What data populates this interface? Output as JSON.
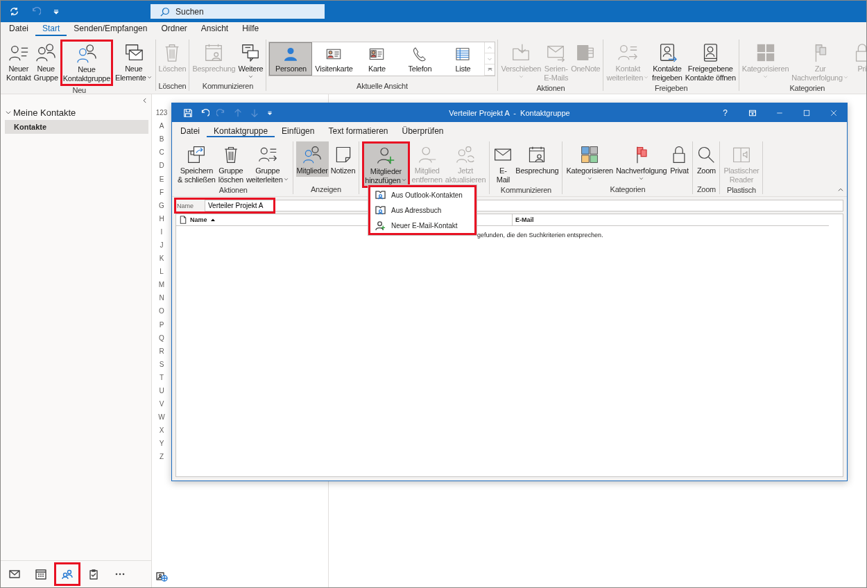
{
  "app_bar": {
    "search_placeholder": "Suchen"
  },
  "menu_tabs": [
    {
      "label": "Datei",
      "selected": false
    },
    {
      "label": "Start",
      "selected": true
    },
    {
      "label": "Senden/Empfangen",
      "selected": false
    },
    {
      "label": "Ordner",
      "selected": false
    },
    {
      "label": "Ansicht",
      "selected": false
    },
    {
      "label": "Hilfe",
      "selected": false
    }
  ],
  "ribbon": {
    "groups": [
      {
        "label": "Neu",
        "kind": "buttons",
        "buttons": [
          {
            "lines": [
              "Neuer",
              "Kontakt"
            ],
            "disabled": false,
            "dropdown": false,
            "highlighted": false
          },
          {
            "lines": [
              "Neue",
              "Gruppe"
            ],
            "disabled": false,
            "dropdown": false,
            "highlighted": false
          },
          {
            "lines": [
              "Neue",
              "Kontaktgruppe"
            ],
            "disabled": false,
            "dropdown": false,
            "highlighted": true
          },
          {
            "lines": [
              "Neue",
              "Elemente"
            ],
            "disabled": false,
            "dropdown": true,
            "highlighted": false
          }
        ]
      },
      {
        "label": "Löschen",
        "kind": "buttons",
        "buttons": [
          {
            "lines": [
              "Löschen"
            ],
            "disabled": true,
            "dropdown": false,
            "highlighted": false
          }
        ]
      },
      {
        "label": "Kommunizieren",
        "kind": "buttons",
        "buttons": [
          {
            "lines": [
              "Besprechung"
            ],
            "disabled": true,
            "dropdown": false,
            "highlighted": false
          },
          {
            "lines": [
              "Weitere"
            ],
            "disabled": false,
            "dropdown": true,
            "highlighted": false
          }
        ]
      },
      {
        "label": "Aktuelle Ansicht",
        "kind": "gallery",
        "views": [
          {
            "label": "Personen",
            "selected": true
          },
          {
            "label": "Visitenkarte",
            "selected": false
          },
          {
            "label": "Karte",
            "selected": false
          },
          {
            "label": "Telefon",
            "selected": false
          },
          {
            "label": "Liste",
            "selected": false
          }
        ]
      },
      {
        "label": "Aktionen",
        "kind": "buttons",
        "buttons": [
          {
            "lines": [
              "Verschieben"
            ],
            "disabled": true,
            "dropdown": true,
            "highlighted": false
          },
          {
            "lines": [
              "Serien-",
              "E-Mails"
            ],
            "disabled": true,
            "dropdown": false,
            "highlighted": false
          },
          {
            "lines": [
              "OneNote"
            ],
            "disabled": true,
            "dropdown": false,
            "highlighted": false
          }
        ]
      },
      {
        "label": "Freigeben",
        "kind": "buttons",
        "buttons": [
          {
            "lines": [
              "Kontakt",
              "weiterleiten"
            ],
            "disabled": true,
            "dropdown": true,
            "highlighted": false
          },
          {
            "lines": [
              "Kontakte",
              "freigeben"
            ],
            "disabled": false,
            "dropdown": false,
            "highlighted": false
          },
          {
            "lines": [
              "Freigegebene",
              "Kontakte öffnen"
            ],
            "disabled": false,
            "dropdown": false,
            "highlighted": false
          }
        ]
      },
      {
        "label": "Kategorien",
        "kind": "buttons",
        "buttons": [
          {
            "lines": [
              "Kategorisieren"
            ],
            "disabled": true,
            "dropdown": true,
            "highlighted": false
          },
          {
            "lines": [
              "Zur",
              "Nachverfolgung"
            ],
            "disabled": true,
            "dropdown": true,
            "highlighted": false
          },
          {
            "lines": [
              "Pri"
            ],
            "disabled": true,
            "dropdown": false,
            "highlighted": false
          }
        ]
      }
    ]
  },
  "sidebar": {
    "header": "Meine Kontakte",
    "expanded": true,
    "folders": [
      {
        "label": "Kontakte",
        "selected": true
      }
    ],
    "nav": [
      {
        "selected": false,
        "highlighted": false
      },
      {
        "selected": false,
        "highlighted": false
      },
      {
        "selected": true,
        "highlighted": true
      },
      {
        "selected": false,
        "highlighted": false
      },
      {
        "selected": false,
        "highlighted": false
      }
    ]
  },
  "letter_index": [
    "123",
    "A",
    "B",
    "C",
    "D",
    "E",
    "F",
    "G",
    "H",
    "I",
    "J",
    "K",
    "L",
    "M",
    "N",
    "O",
    "P",
    "Q",
    "R",
    "S",
    "T",
    "U",
    "V",
    "W",
    "X",
    "Y",
    "Z"
  ],
  "contact_window": {
    "title": "Verteiler Projekt A  -  Kontaktgruppe",
    "help": "?",
    "tabs": [
      {
        "label": "Datei",
        "selected": false
      },
      {
        "label": "Kontaktgruppe",
        "selected": true
      },
      {
        "label": "Einfügen",
        "selected": false
      },
      {
        "label": "Text formatieren",
        "selected": false
      },
      {
        "label": "Überprüfen",
        "selected": false
      }
    ],
    "groups": [
      {
        "label": "Aktionen",
        "buttons": [
          {
            "lines": [
              "Speichern",
              "& schließen"
            ],
            "disabled": false,
            "dropdown": false,
            "pressed": false,
            "highlighted": false
          },
          {
            "lines": [
              "Gruppe",
              "löschen"
            ],
            "disabled": false,
            "dropdown": false,
            "pressed": false,
            "highlighted": false
          },
          {
            "lines": [
              "Gruppe",
              "weiterleiten"
            ],
            "disabled": false,
            "dropdown": true,
            "pressed": false,
            "highlighted": false
          }
        ]
      },
      {
        "label": "Anzeigen",
        "buttons": [
          {
            "lines": [
              "Mitglieder"
            ],
            "disabled": false,
            "dropdown": false,
            "pressed": true,
            "highlighted": false
          },
          {
            "lines": [
              "Notizen"
            ],
            "disabled": false,
            "dropdown": false,
            "pressed": false,
            "highlighted": false
          }
        ]
      },
      {
        "buttons": [
          {
            "lines": [
              "Mitglieder",
              "hinzufügen"
            ],
            "disabled": false,
            "dropdown": true,
            "pressed": true,
            "highlighted": true
          },
          {
            "lines": [
              "Mitglied",
              "entfernen"
            ],
            "disabled": true,
            "dropdown": false,
            "pressed": false,
            "highlighted": false
          },
          {
            "lines": [
              "Jetzt",
              "aktualisieren"
            ],
            "disabled": true,
            "dropdown": false,
            "pressed": false,
            "highlighted": false
          }
        ]
      },
      {
        "label": "Kommunizieren",
        "buttons": [
          {
            "lines": [
              "E-",
              "Mail"
            ],
            "disabled": false,
            "dropdown": false,
            "pressed": false,
            "highlighted": false
          },
          {
            "lines": [
              "Besprechung"
            ],
            "disabled": false,
            "dropdown": false,
            "pressed": false,
            "highlighted": false
          }
        ]
      },
      {
        "label": "Kategorien",
        "buttons": [
          {
            "lines": [
              "Kategorisieren"
            ],
            "disabled": false,
            "dropdown": true,
            "pressed": false,
            "highlighted": false
          },
          {
            "lines": [
              "Nachverfolgung"
            ],
            "disabled": false,
            "dropdown": true,
            "pressed": false,
            "highlighted": false
          },
          {
            "lines": [
              "Privat"
            ],
            "disabled": false,
            "dropdown": false,
            "pressed": false,
            "highlighted": false
          }
        ]
      },
      {
        "label": "Zoom",
        "buttons": [
          {
            "lines": [
              "Zoom"
            ],
            "disabled": false,
            "dropdown": false,
            "pressed": false,
            "highlighted": false
          }
        ]
      },
      {
        "label": "Plastisch",
        "buttons": [
          {
            "lines": [
              "Plastischer",
              "Reader"
            ],
            "disabled": true,
            "dropdown": false,
            "pressed": false,
            "highlighted": false
          }
        ]
      }
    ],
    "name_field": {
      "label": "Name",
      "value": "Verteiler Projekt A",
      "highlighted": true
    },
    "columns": [
      {
        "label": "Name",
        "sorted": true
      },
      {
        "label": "E-Mail",
        "sorted": false
      }
    ],
    "message": "gefunden, die den Suchkriterien entsprechen.",
    "dropdown_menu": {
      "highlighted": true,
      "items": [
        {
          "label": "Aus Outlook-Kontakten"
        },
        {
          "label": "Aus Adressbuch"
        },
        {
          "label": "Neuer E-Mail-Kontakt"
        }
      ]
    }
  }
}
